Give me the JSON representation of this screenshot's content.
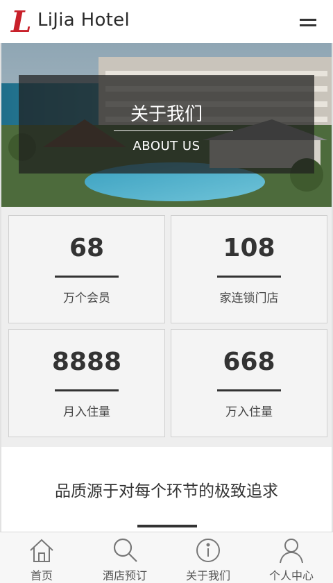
{
  "header": {
    "logo_letter": "L",
    "logo_text": "LiJia Hotel",
    "menu_icon": "hamburger-menu-icon"
  },
  "banner": {
    "title": "关于我们",
    "subtitle": "ABOUT US"
  },
  "stats": [
    {
      "number": "68",
      "label": "万个会员"
    },
    {
      "number": "108",
      "label": "家连锁门店"
    },
    {
      "number": "8888",
      "label": "月入住量"
    },
    {
      "number": "668",
      "label": "万入住量"
    }
  ],
  "quality": {
    "title": "品质源于对每个环节的极致追求"
  },
  "bottom_nav": [
    {
      "label": "首页",
      "icon": "home-icon"
    },
    {
      "label": "酒店预订",
      "icon": "search-icon"
    },
    {
      "label": "关于我们",
      "icon": "info-icon"
    },
    {
      "label": "个人中心",
      "icon": "user-icon"
    }
  ],
  "colors": {
    "logo_red": "#c8202a",
    "text_dark": "#333333",
    "stat_bg": "#f4f4f4",
    "section_bg": "#eeeeee"
  }
}
